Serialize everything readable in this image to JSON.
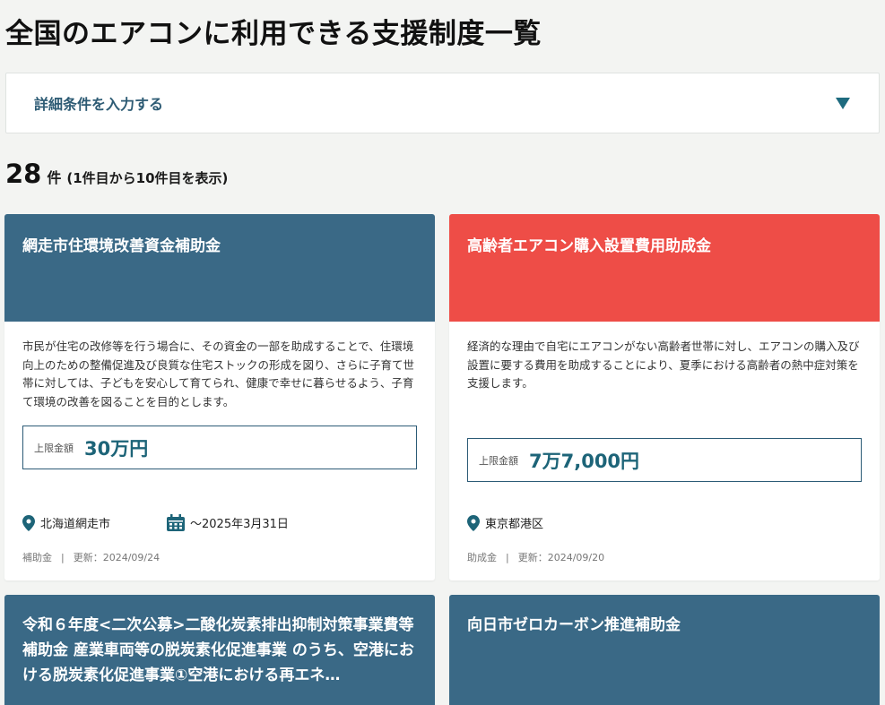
{
  "page": {
    "title": "全国のエアコンに利用できる支援制度一覧"
  },
  "filter": {
    "label": "詳細条件を入力する"
  },
  "results": {
    "count": "28",
    "unit": "件",
    "range": "(1件目から10件目を表示)"
  },
  "colors": {
    "blue_header": "#3a6986",
    "red_header": "#ee4d47",
    "accent": "#1d6478"
  },
  "cards": [
    {
      "title": "網走市住環境改善資金補助金",
      "description": "市民が住宅の改修等を行う場合に、その資金の一部を助成することで、住環境向上のための整備促進及び良質な住宅ストックの形成を図り、さらに子育て世帯に対しては、子どもを安心して育てられ、健康で幸せに暮らせるよう、子育て環境の改善を図ることを目的とします。",
      "limit_label": "上限金額",
      "limit_value": "30万円",
      "location": "北海道網走市",
      "deadline": "～2025年3月31日",
      "type": "補助金",
      "updated": "更新：2024/09/24",
      "header_color": "blue"
    },
    {
      "title": "高齢者エアコン購入設置費用助成金",
      "description": "経済的な理由で自宅にエアコンがない高齢者世帯に対し、エアコンの購入及び設置に要する費用を助成することにより、夏季における高齢者の熱中症対策を支援します。",
      "limit_label": "上限金額",
      "limit_value": "7万7,000円",
      "location": "東京都港区",
      "type": "助成金",
      "updated": "更新：2024/09/20",
      "header_color": "red"
    },
    {
      "title": "令和６年度<二次公募>二酸化炭素排出抑制対策事業費等補助金 産業車両等の脱炭素化促進事業 のうち、空港における脱炭素化促進事業①空港における再エネ…",
      "header_color": "blue"
    },
    {
      "title": "向日市ゼロカーボン推進補助金",
      "header_color": "blue"
    }
  ],
  "footer_separator": "|",
  "icons": {
    "location": "map-pin-icon",
    "calendar": "calendar-icon",
    "caret": "caret-down-icon"
  }
}
